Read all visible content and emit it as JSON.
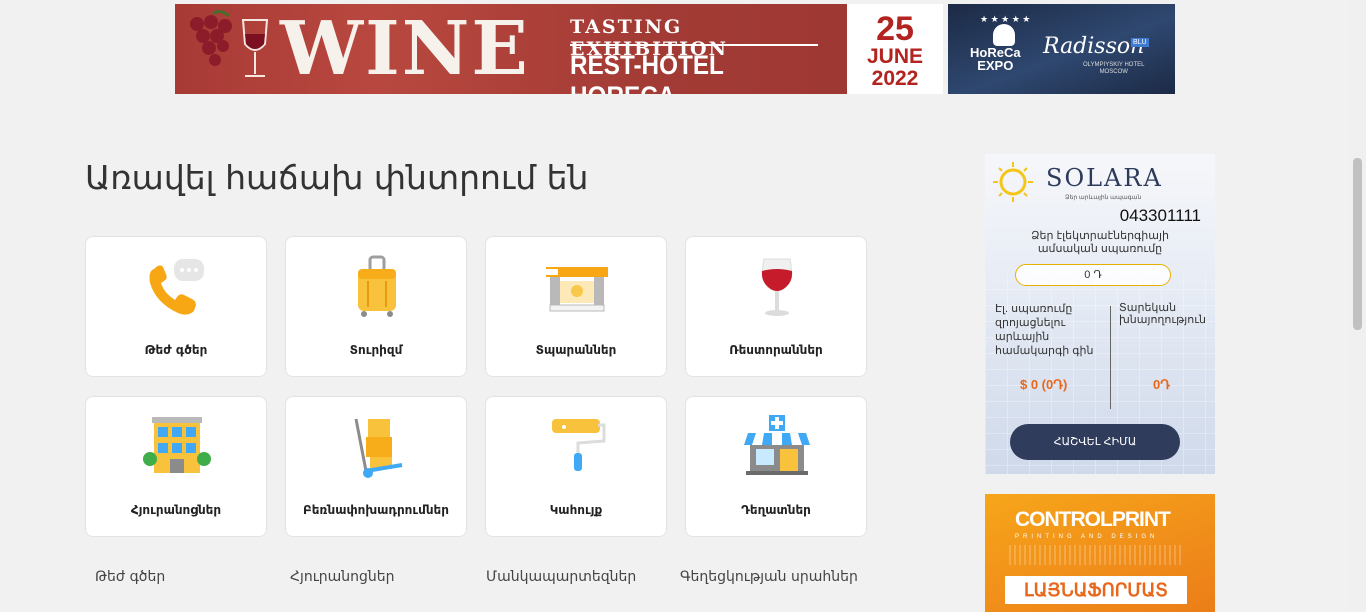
{
  "banner": {
    "wine_word": "WINE",
    "line1": "TASTING EXHIBITION",
    "line2": "REST-HOTEL HORECA",
    "date_day": "25",
    "date_month": "JUNE",
    "date_year": "2022",
    "horeca": "HoReCa\nEXPO",
    "radisson": "Radisson",
    "blu": "BLU",
    "olympic": "OLYMPIYSKIY HOTEL\nMOSCOW"
  },
  "heading": "Առավել հաճախ փնտրում են",
  "categories": [
    {
      "label": "Թեժ գծեր",
      "icon": "phone-icon"
    },
    {
      "label": "Տուրիզմ",
      "icon": "suitcase-icon"
    },
    {
      "label": "Տպարաններ",
      "icon": "printer-icon"
    },
    {
      "label": "Ռեստորաններ",
      "icon": "wine-glass-icon"
    },
    {
      "label": "Հյուրանոցներ",
      "icon": "hotel-icon"
    },
    {
      "label": "Բեռնափոխադրումներ",
      "icon": "hand-truck-icon"
    },
    {
      "label": "Կահույք",
      "icon": "paint-roller-icon"
    },
    {
      "label": "Դեղատներ",
      "icon": "pharmacy-icon"
    }
  ],
  "links": {
    "row1": [
      "Թեժ գծեր",
      "Հյուրանոցներ",
      "Մանկապարտեզներ",
      "Գեղեցկության սրահներ"
    ]
  },
  "solara": {
    "name": "SOLARA",
    "subtitle": "Ձեր արևային ապագան",
    "phone": "043301111",
    "question": "Ձեր էլեկտրաէներգիայի ամսական սպառումը",
    "input_value": "0 Դ",
    "col1": "Էլ. սպառումը զրոյացնելու արևային համակարգի գին",
    "col2": "Տարեկան խնայողություն",
    "value1": "$ 0 (0Դ)",
    "value2": "0Դ",
    "button": "ՀԱՇՎԵԼ ՀԻՄԱ"
  },
  "controlprint": {
    "logo": "CONTROLPRINT",
    "sub": "PRINTING AND DESIGN",
    "button": "ԼԱՅՆԱՖՈՐՄԱՏ"
  }
}
